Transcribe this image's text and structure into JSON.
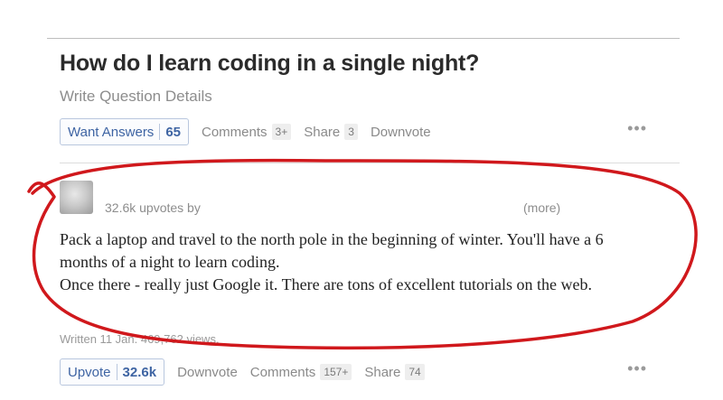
{
  "question": {
    "title": "How do I learn coding in a single night?",
    "details_link": "Write Question Details",
    "want_answers_label": "Want Answers",
    "want_answers_count": "65",
    "comments_label": "Comments",
    "comments_count": "3+",
    "share_label": "Share",
    "share_count": "3",
    "downvote_label": "Downvote",
    "more_icon": "•••"
  },
  "answer": {
    "upvotes_by": "32.6k upvotes by",
    "more_label": "(more)",
    "text_1": "Pack a laptop and travel to the north pole in the beginning of winter. You'll have a 6 months of a night to learn coding.",
    "text_2": "Once there - really just Google it. There are tons of excellent tutorials on the web.",
    "meta": "Written 11 Jan. 469,762 views.",
    "upvote_label": "Upvote",
    "upvote_count": "32.6k",
    "downvote_label": "Downvote",
    "comments_label": "Comments",
    "comments_count": "157+",
    "share_label": "Share",
    "share_count": "74",
    "more_icon": "•••"
  },
  "colors": {
    "link_blue": "#3e64a3",
    "annotation_red": "#d0181c",
    "muted_gray": "#8d8d8d"
  }
}
